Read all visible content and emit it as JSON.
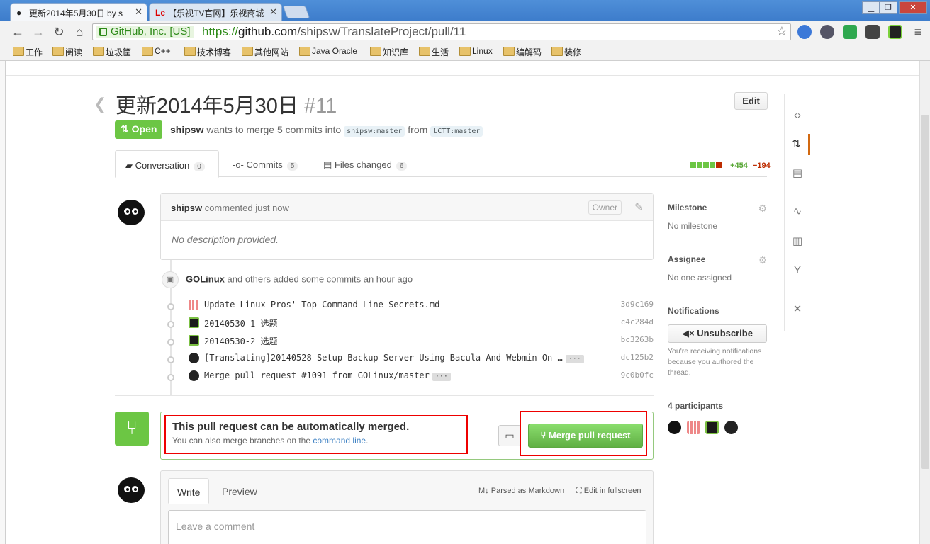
{
  "browser": {
    "tabs": [
      {
        "label": "更新2014年5月30日 by s",
        "icon": "github-icon",
        "active": true
      },
      {
        "label": "【乐视TV官网】乐视商城",
        "icon": "letv-icon",
        "active": false
      }
    ],
    "secure_label": "GitHub, Inc. [US]",
    "url_scheme": "https://",
    "url_host": "github.com",
    "url_path": "/shipsw/TranslateProject/pull/11",
    "bookmarks": [
      "工作",
      "阅读",
      "垃圾筐",
      "C++",
      "技术博客",
      "其他网站",
      "Java Oracle",
      "知识库",
      "生活",
      "Linux",
      "编解码",
      "装修"
    ]
  },
  "pr": {
    "title": "更新2014年5月30日",
    "number": "#11",
    "edit_label": "Edit",
    "state": "Open",
    "author": "shipsw",
    "meta_text": "wants to merge 5 commits into",
    "base_branch": "shipsw:master",
    "from_text": "from",
    "head_branch": "LCTT:master"
  },
  "tabs": [
    {
      "label": "Conversation",
      "count": "0"
    },
    {
      "label": "Commits",
      "count": "5"
    },
    {
      "label": "Files changed",
      "count": "6"
    }
  ],
  "diffstat": {
    "additions": "+454",
    "deletions": "−194",
    "add_color": "#6cc644",
    "del_color": "#bd2c00"
  },
  "comment": {
    "author": "shipsw",
    "action": "commented just now",
    "owner_badge": "Owner",
    "body": "No description provided."
  },
  "commits_header": {
    "author": "GOLinux",
    "text": "and others added some commits an hour ago"
  },
  "commits": [
    {
      "message": "Update Linux Pros' Top Command Line Secrets.md",
      "sha": "3d9c169",
      "more": false
    },
    {
      "message": "20140530-1 选题",
      "sha": "c4c284d",
      "more": false
    },
    {
      "message": "20140530-2 选题",
      "sha": "bc3263b",
      "more": false
    },
    {
      "message": "[Translating]20140528 Setup Backup Server Using Bacula And Webmin On …",
      "sha": "dc125b2",
      "more": true
    },
    {
      "message": "Merge pull request #1091 from GOLinux/master",
      "sha": "9c0b0fc",
      "more": true
    }
  ],
  "merge": {
    "title": "This pull request can be automatically merged.",
    "sub_text": "You can also merge branches on the",
    "sub_link": "command line",
    "sub_end": ".",
    "button_label": "Merge pull request",
    "accent": "#6cc644"
  },
  "new_comment": {
    "write_tab": "Write",
    "preview_tab": "Preview",
    "markdown_label": "Parsed as Markdown",
    "fullscreen_label": "Edit in fullscreen",
    "placeholder": "Leave a comment"
  },
  "sidebar": {
    "milestone_title": "Milestone",
    "milestone_value": "No milestone",
    "assignee_title": "Assignee",
    "assignee_value": "No one assigned",
    "notifications_title": "Notifications",
    "unsubscribe_label": "Unsubscribe",
    "notifications_note": "You're receiving notifications because you authored the thread.",
    "participants_title": "4 participants"
  }
}
